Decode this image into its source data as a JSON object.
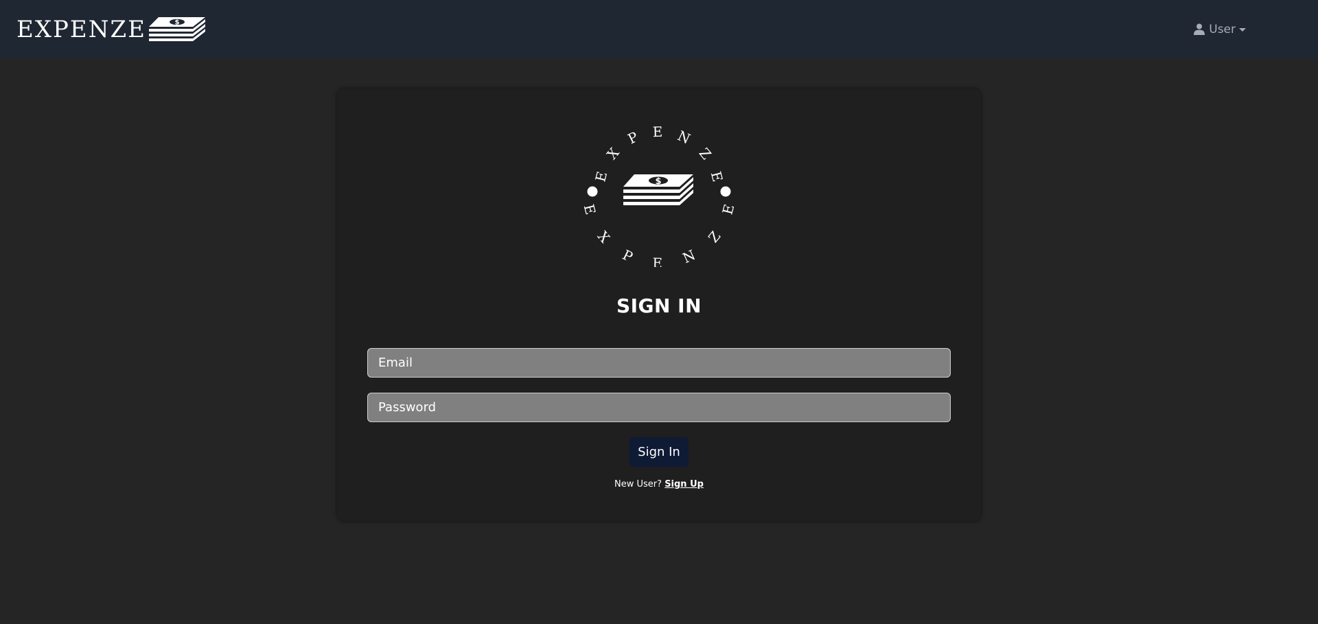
{
  "navbar": {
    "brand_text": "EXPENZE",
    "user_label": "User"
  },
  "logo": {
    "ring_text": "EXPENZE",
    "icon": "money-stack-icon"
  },
  "form": {
    "title": "SIGN IN",
    "email_placeholder": "Email",
    "password_placeholder": "Password",
    "submit_label": "Sign In",
    "new_user_text": "New User?",
    "signup_link": "Sign Up"
  },
  "colors": {
    "navbar_bg": "#1f2733",
    "page_bg": "#252525",
    "card_bg": "#1f1f1f",
    "input_bg": "#808080",
    "button_bg": "#0f1a35"
  }
}
